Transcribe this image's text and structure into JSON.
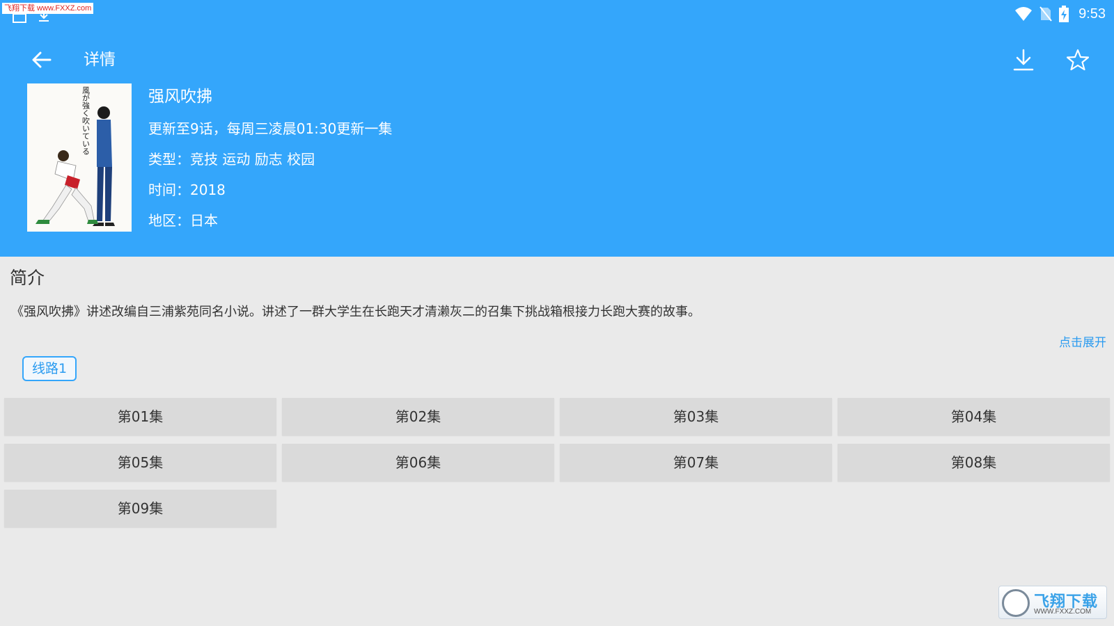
{
  "colors": {
    "primary": "#34a6fb",
    "background": "#eaeaea",
    "episode_bg": "#dadada",
    "link": "#2a9bf0"
  },
  "status_bar": {
    "watermark": "飞翔下载 www.FXXZ.com",
    "time": "9:53",
    "icons": [
      "image-notification-icon",
      "download-notification-icon",
      "wifi-icon",
      "no-sim-icon",
      "battery-charging-icon"
    ]
  },
  "toolbar": {
    "title": "详情",
    "back_icon": "back-arrow-icon",
    "download_icon": "download-icon",
    "favorite_icon": "star-outline-icon"
  },
  "detail": {
    "title": "强风吹拂",
    "update": "更新至9话，每周三凌晨01:30更新一集",
    "genre": "类型：竞技  运动  励志  校园",
    "year": "时间：2018",
    "region": "地区：日本",
    "poster_text": "風が強く吹いている"
  },
  "synopsis": {
    "heading": "简介",
    "text": "《强风吹拂》讲述改编自三浦紫苑同名小说。讲述了一群大学生在长跑天才清濑灰二的召集下挑战箱根接力长跑大赛的故事。",
    "expand_label": "点击展开"
  },
  "routes": [
    {
      "label": "线路1",
      "selected": true
    }
  ],
  "episodes": [
    "第01集",
    "第02集",
    "第03集",
    "第04集",
    "第05集",
    "第06集",
    "第07集",
    "第08集",
    "第09集"
  ],
  "corner_watermark": {
    "text": "飞翔下载",
    "url": "WWW.FXXZ.COM"
  }
}
